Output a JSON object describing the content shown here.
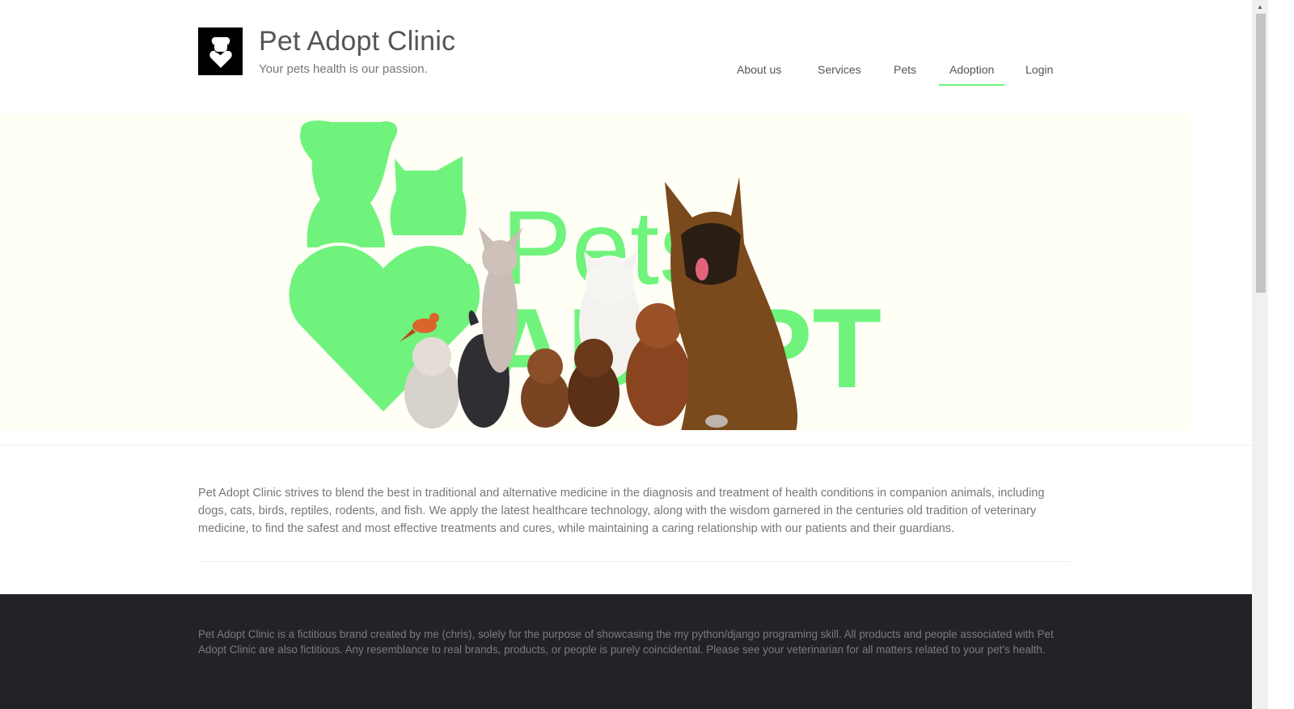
{
  "header": {
    "title": "Pet Adopt Clinic",
    "tagline": "Your pets health is our passion."
  },
  "nav": {
    "items": [
      {
        "label": "About us",
        "active": false
      },
      {
        "label": "Services",
        "active": false
      },
      {
        "label": "Pets",
        "active": false
      },
      {
        "label": "Adoption",
        "active": true
      },
      {
        "label": "Login",
        "active": false
      }
    ]
  },
  "hero": {
    "line1": "Pets",
    "line2": "ADOPT",
    "accent_color": "#6ff37c",
    "background_color": "#fffff6"
  },
  "intro": {
    "text": "Pet Adopt Clinic strives to blend the best in traditional and alternative medicine in the diagnosis and treatment of health conditions in companion animals, including dogs, cats, birds, reptiles, rodents, and fish. We apply the latest healthcare technology, along with the wisdom garnered in the centuries old tradition of veterinary medicine, to find the safest and most effective treatments and cures, while maintaining a caring relationship with our patients and their guardians."
  },
  "footer": {
    "text": "Pet Adopt Clinic is a fictitious brand created by me (chris), solely for the purpose of showcasing the my python/django programing skill. All products and people associated with Pet Adopt Clinic are also fictitious. Any resemblance to real brands, products, or people is purely coincidental. Please see your veterinarian for all matters related to your pet's health.",
    "background_color": "#222326"
  },
  "icons": {
    "logo": "dog-heart-logo-icon",
    "scroll_up": "chevron-up-icon"
  }
}
